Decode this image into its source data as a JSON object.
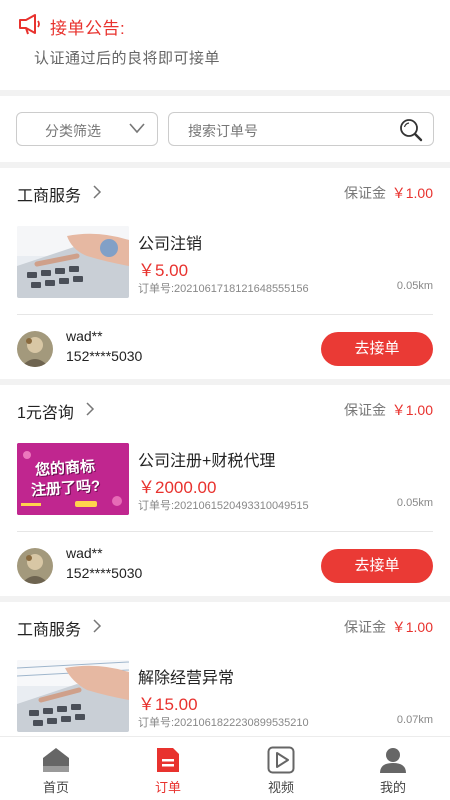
{
  "notice": {
    "title": "接单公告:",
    "text": "认证通过后的良将即可接单"
  },
  "filter": {
    "category_label": "分类筛选",
    "search_placeholder": "搜索订单号"
  },
  "orders": [
    {
      "category": "工商服务",
      "deposit_label": "保证金",
      "deposit_value": "￥1.00",
      "title": "公司注销",
      "price": "￥5.00",
      "order_no": "订单号:20210617181216485551​56",
      "distance": "0.05km",
      "user_name": "wad**",
      "user_phone": "152****5030",
      "action": "去接单",
      "thumb": "calculator-thumbnail"
    },
    {
      "category": "1元咨询",
      "deposit_label": "保证金",
      "deposit_value": "￥1.00",
      "title": "公司注册+财税代理",
      "price": "￥2000.00",
      "order_no": "订单号:202106152049331004​9515",
      "distance": "0.05km",
      "user_name": "wad**",
      "user_phone": "152****5030",
      "action": "去接单",
      "thumb": "trademark-promo-thumbnail",
      "thumb_text_line1": "您的商标",
      "thumb_text_line2": "注册了吗?"
    },
    {
      "category": "工商服务",
      "deposit_label": "保证金",
      "deposit_value": "￥1.00",
      "title": "解除经营异常",
      "price": "￥15.00",
      "order_no": "订单号:202106182223089953​5210",
      "distance": "0.07km",
      "thumb": "calculator-thumbnail"
    }
  ],
  "tabs": [
    {
      "label": "首页",
      "icon": "home-icon",
      "active": false
    },
    {
      "label": "订单",
      "icon": "order-icon",
      "active": true
    },
    {
      "label": "视频",
      "icon": "video-icon",
      "active": false
    },
    {
      "label": "我的",
      "icon": "profile-icon",
      "active": false
    }
  ],
  "colors": {
    "accent": "#e8322e",
    "button": "#ea3a35",
    "background": "#f2f2f2",
    "promo_magenta": "#c0268f"
  }
}
